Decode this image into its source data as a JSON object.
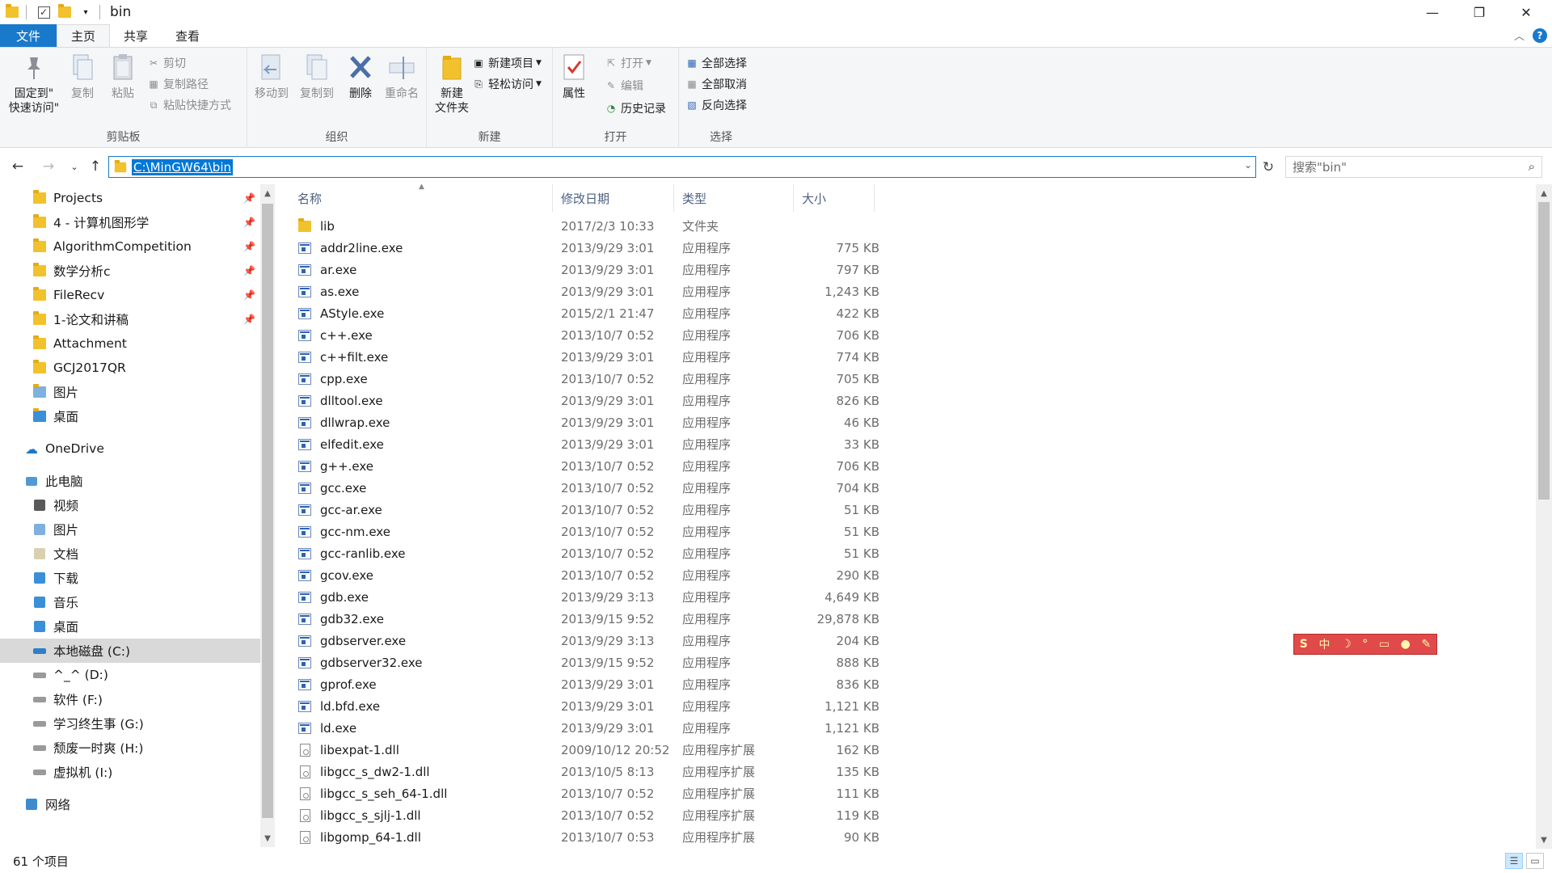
{
  "window": {
    "title": "bin",
    "controls": {
      "minimize": "—",
      "maximize": "❐",
      "close": "✕"
    }
  },
  "ribbon_tabs": [
    {
      "label": "文件"
    },
    {
      "label": "主页"
    },
    {
      "label": "共享"
    },
    {
      "label": "查看"
    }
  ],
  "ribbon": {
    "clipboard": {
      "label": "剪贴板",
      "pin": "固定到\"\n快速访问\"",
      "copy": "复制",
      "paste": "粘贴",
      "cut": "剪切",
      "copy_path": "复制路径",
      "paste_shortcut": "粘贴快捷方式"
    },
    "organize": {
      "label": "组织",
      "move_to": "移动到",
      "copy_to": "复制到",
      "delete": "删除",
      "rename": "重命名"
    },
    "new": {
      "label": "新建",
      "new_folder": "新建\n文件夹",
      "new_item": "新建项目",
      "easy_access": "轻松访问"
    },
    "open": {
      "label": "打开",
      "properties": "属性",
      "open": "打开",
      "edit": "编辑",
      "history": "历史记录"
    },
    "select": {
      "label": "选择",
      "select_all": "全部选择",
      "select_none": "全部取消",
      "invert": "反向选择"
    }
  },
  "address": {
    "path": "C:\\MinGW64\\bin",
    "search_placeholder": "搜索\"bin\""
  },
  "nav_pane": {
    "quick_access": [
      {
        "label": "Projects",
        "pinned": true
      },
      {
        "label": "4 - 计算机图形学",
        "pinned": true
      },
      {
        "label": "AlgorithmCompetition",
        "pinned": true
      },
      {
        "label": "数学分析c",
        "pinned": true
      },
      {
        "label": "FileRecv",
        "pinned": true
      },
      {
        "label": "1-论文和讲稿",
        "pinned": true
      },
      {
        "label": "Attachment",
        "pinned": false
      },
      {
        "label": "GCJ2017QR",
        "pinned": false
      },
      {
        "label": "图片",
        "pinned": false
      },
      {
        "label": "桌面",
        "pinned": false
      }
    ],
    "onedrive": "OneDrive",
    "this_pc": "此电脑",
    "pc_items": [
      {
        "label": "视频"
      },
      {
        "label": "图片"
      },
      {
        "label": "文档"
      },
      {
        "label": "下载"
      },
      {
        "label": "音乐"
      },
      {
        "label": "桌面"
      },
      {
        "label": "本地磁盘 (C:)",
        "selected": true
      },
      {
        "label": "^_^ (D:)"
      },
      {
        "label": "软件 (F:)"
      },
      {
        "label": "学习终生事 (G:)"
      },
      {
        "label": "颓废一时爽 (H:)"
      },
      {
        "label": "虚拟机 (I:)"
      }
    ],
    "network": "网络"
  },
  "file_list": {
    "columns": {
      "name": "名称",
      "date": "修改日期",
      "type": "类型",
      "size": "大小"
    },
    "rows": [
      {
        "name": "lib",
        "date": "2017/2/3 10:33",
        "type": "文件夹",
        "size": "",
        "kind": "folder"
      },
      {
        "name": "addr2line.exe",
        "date": "2013/9/29 3:01",
        "type": "应用程序",
        "size": "775 KB",
        "kind": "exe"
      },
      {
        "name": "ar.exe",
        "date": "2013/9/29 3:01",
        "type": "应用程序",
        "size": "797 KB",
        "kind": "exe"
      },
      {
        "name": "as.exe",
        "date": "2013/9/29 3:01",
        "type": "应用程序",
        "size": "1,243 KB",
        "kind": "exe"
      },
      {
        "name": "AStyle.exe",
        "date": "2015/2/1 21:47",
        "type": "应用程序",
        "size": "422 KB",
        "kind": "exe"
      },
      {
        "name": "c++.exe",
        "date": "2013/10/7 0:52",
        "type": "应用程序",
        "size": "706 KB",
        "kind": "exe"
      },
      {
        "name": "c++filt.exe",
        "date": "2013/9/29 3:01",
        "type": "应用程序",
        "size": "774 KB",
        "kind": "exe"
      },
      {
        "name": "cpp.exe",
        "date": "2013/10/7 0:52",
        "type": "应用程序",
        "size": "705 KB",
        "kind": "exe"
      },
      {
        "name": "dlltool.exe",
        "date": "2013/9/29 3:01",
        "type": "应用程序",
        "size": "826 KB",
        "kind": "exe"
      },
      {
        "name": "dllwrap.exe",
        "date": "2013/9/29 3:01",
        "type": "应用程序",
        "size": "46 KB",
        "kind": "exe"
      },
      {
        "name": "elfedit.exe",
        "date": "2013/9/29 3:01",
        "type": "应用程序",
        "size": "33 KB",
        "kind": "exe"
      },
      {
        "name": "g++.exe",
        "date": "2013/10/7 0:52",
        "type": "应用程序",
        "size": "706 KB",
        "kind": "exe"
      },
      {
        "name": "gcc.exe",
        "date": "2013/10/7 0:52",
        "type": "应用程序",
        "size": "704 KB",
        "kind": "exe"
      },
      {
        "name": "gcc-ar.exe",
        "date": "2013/10/7 0:52",
        "type": "应用程序",
        "size": "51 KB",
        "kind": "exe"
      },
      {
        "name": "gcc-nm.exe",
        "date": "2013/10/7 0:52",
        "type": "应用程序",
        "size": "51 KB",
        "kind": "exe"
      },
      {
        "name": "gcc-ranlib.exe",
        "date": "2013/10/7 0:52",
        "type": "应用程序",
        "size": "51 KB",
        "kind": "exe"
      },
      {
        "name": "gcov.exe",
        "date": "2013/10/7 0:52",
        "type": "应用程序",
        "size": "290 KB",
        "kind": "exe"
      },
      {
        "name": "gdb.exe",
        "date": "2013/9/29 3:13",
        "type": "应用程序",
        "size": "4,649 KB",
        "kind": "exe"
      },
      {
        "name": "gdb32.exe",
        "date": "2013/9/15 9:52",
        "type": "应用程序",
        "size": "29,878 KB",
        "kind": "exe"
      },
      {
        "name": "gdbserver.exe",
        "date": "2013/9/29 3:13",
        "type": "应用程序",
        "size": "204 KB",
        "kind": "exe"
      },
      {
        "name": "gdbserver32.exe",
        "date": "2013/9/15 9:52",
        "type": "应用程序",
        "size": "888 KB",
        "kind": "exe"
      },
      {
        "name": "gprof.exe",
        "date": "2013/9/29 3:01",
        "type": "应用程序",
        "size": "836 KB",
        "kind": "exe"
      },
      {
        "name": "ld.bfd.exe",
        "date": "2013/9/29 3:01",
        "type": "应用程序",
        "size": "1,121 KB",
        "kind": "exe"
      },
      {
        "name": "ld.exe",
        "date": "2013/9/29 3:01",
        "type": "应用程序",
        "size": "1,121 KB",
        "kind": "exe"
      },
      {
        "name": "libexpat-1.dll",
        "date": "2009/10/12 20:52",
        "type": "应用程序扩展",
        "size": "162 KB",
        "kind": "dll"
      },
      {
        "name": "libgcc_s_dw2-1.dll",
        "date": "2013/10/5 8:13",
        "type": "应用程序扩展",
        "size": "135 KB",
        "kind": "dll"
      },
      {
        "name": "libgcc_s_seh_64-1.dll",
        "date": "2013/10/7 0:52",
        "type": "应用程序扩展",
        "size": "111 KB",
        "kind": "dll"
      },
      {
        "name": "libgcc_s_sjlj-1.dll",
        "date": "2013/10/7 0:52",
        "type": "应用程序扩展",
        "size": "119 KB",
        "kind": "dll"
      },
      {
        "name": "libgomp_64-1.dll",
        "date": "2013/10/7 0:53",
        "type": "应用程序扩展",
        "size": "90 KB",
        "kind": "dll"
      }
    ]
  },
  "ime_toolbar": {
    "label": "S",
    "mode": "中"
  },
  "status": {
    "item_count": "61 个项目"
  },
  "colors": {
    "accent": "#1979ca",
    "folder": "#f2c12e",
    "ime": "#e04a4a"
  }
}
